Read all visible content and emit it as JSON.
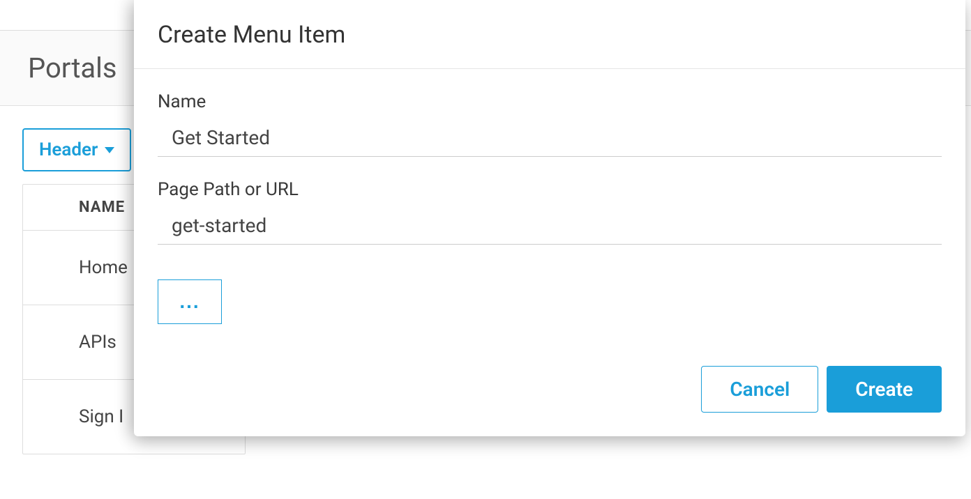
{
  "background": {
    "page_title": "Portals",
    "dropdown_label": "Header",
    "table": {
      "header": "NAME",
      "rows": [
        "Home",
        "APIs",
        "Sign I"
      ]
    }
  },
  "modal": {
    "title": "Create Menu Item",
    "fields": {
      "name": {
        "label": "Name",
        "value": "Get Started"
      },
      "path": {
        "label": "Page Path or URL",
        "value": "get-started"
      }
    },
    "more_label": "...",
    "actions": {
      "cancel": "Cancel",
      "create": "Create"
    }
  }
}
